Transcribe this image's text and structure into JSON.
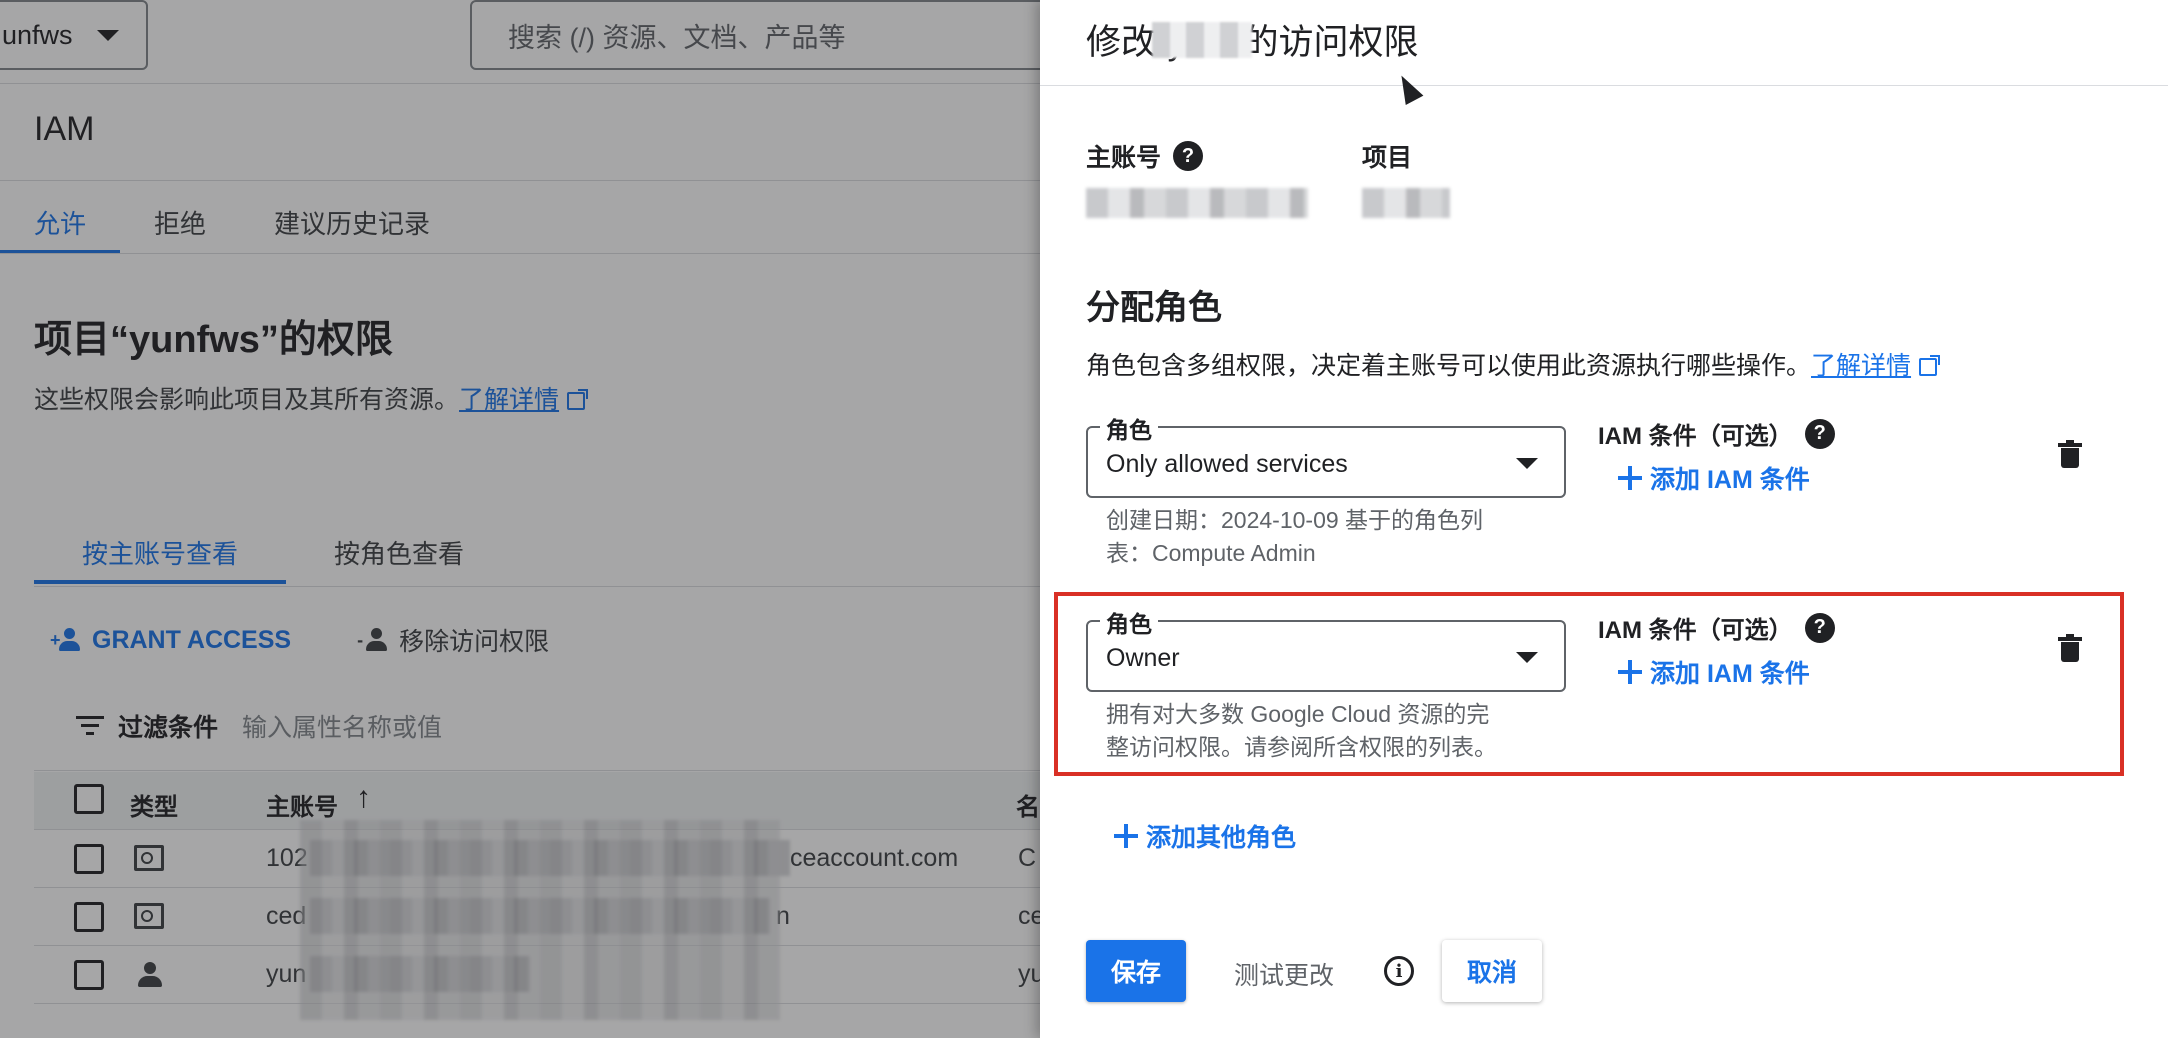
{
  "topbar": {
    "project_name": "unfws",
    "search_placeholder": "搜索 (/) 资源、文档、产品等"
  },
  "page": {
    "title": "IAM",
    "tabs": [
      {
        "label": "允许",
        "active": true
      },
      {
        "label": "拒绝",
        "active": false
      },
      {
        "label": "建议历史记录",
        "active": false
      }
    ],
    "permissions_title": "项目“yunfws”的权限",
    "permissions_desc": "这些权限会影响此项目及其所有资源。",
    "learn_more": "了解详情",
    "view_tabs": [
      {
        "label": "按主账号查看",
        "active": true
      },
      {
        "label": "按角色查看",
        "active": false
      }
    ],
    "grant_access": "GRANT ACCESS",
    "remove_access": "移除访问权限",
    "filter_label": "过滤条件",
    "filter_placeholder": "输入属性名称或值",
    "table": {
      "col_type": "类型",
      "col_principal": "主账号",
      "col_name": "名",
      "rows": [
        {
          "type_icon": "service-account-icon",
          "principal_start": "102",
          "principal_end": "ceaccount.com",
          "name": "C"
        },
        {
          "type_icon": "service-account-icon",
          "principal_start": "ced",
          "principal_end": "n",
          "name": "ce"
        },
        {
          "type_icon": "person-icon",
          "principal_start": "yun",
          "principal_end": "",
          "name": "yu"
        }
      ]
    }
  },
  "panel": {
    "title": "修改“yu    s”的访问权限",
    "principal_label": "主账号",
    "project_label": "项目",
    "assign_title": "分配角色",
    "assign_desc": "角色包含多组权限，决定着主账号可以使用此资源执行哪些操作。",
    "learn_more": "了解详情",
    "roles": [
      {
        "field_label": "角色",
        "value": "Only allowed services",
        "help_line1": "创建日期：2024-10-09 基于的角色列",
        "help_line2": "表：Compute Admin",
        "condition_label": "IAM 条件（可选）",
        "add_condition": "添加 IAM 条件"
      },
      {
        "field_label": "角色",
        "value": "Owner",
        "help_line1": "拥有对大多数 Google Cloud 资源的完",
        "help_line2": "整访问权限。请参阅所含权限的列表。",
        "condition_label": "IAM 条件（可选）",
        "add_condition": "添加 IAM 条件"
      }
    ],
    "add_role": "添加其他角色",
    "save": "保存",
    "test": "测试更改",
    "cancel": "取消"
  },
  "colors": {
    "accent": "#1a73e8",
    "highlight": "#d93025"
  }
}
